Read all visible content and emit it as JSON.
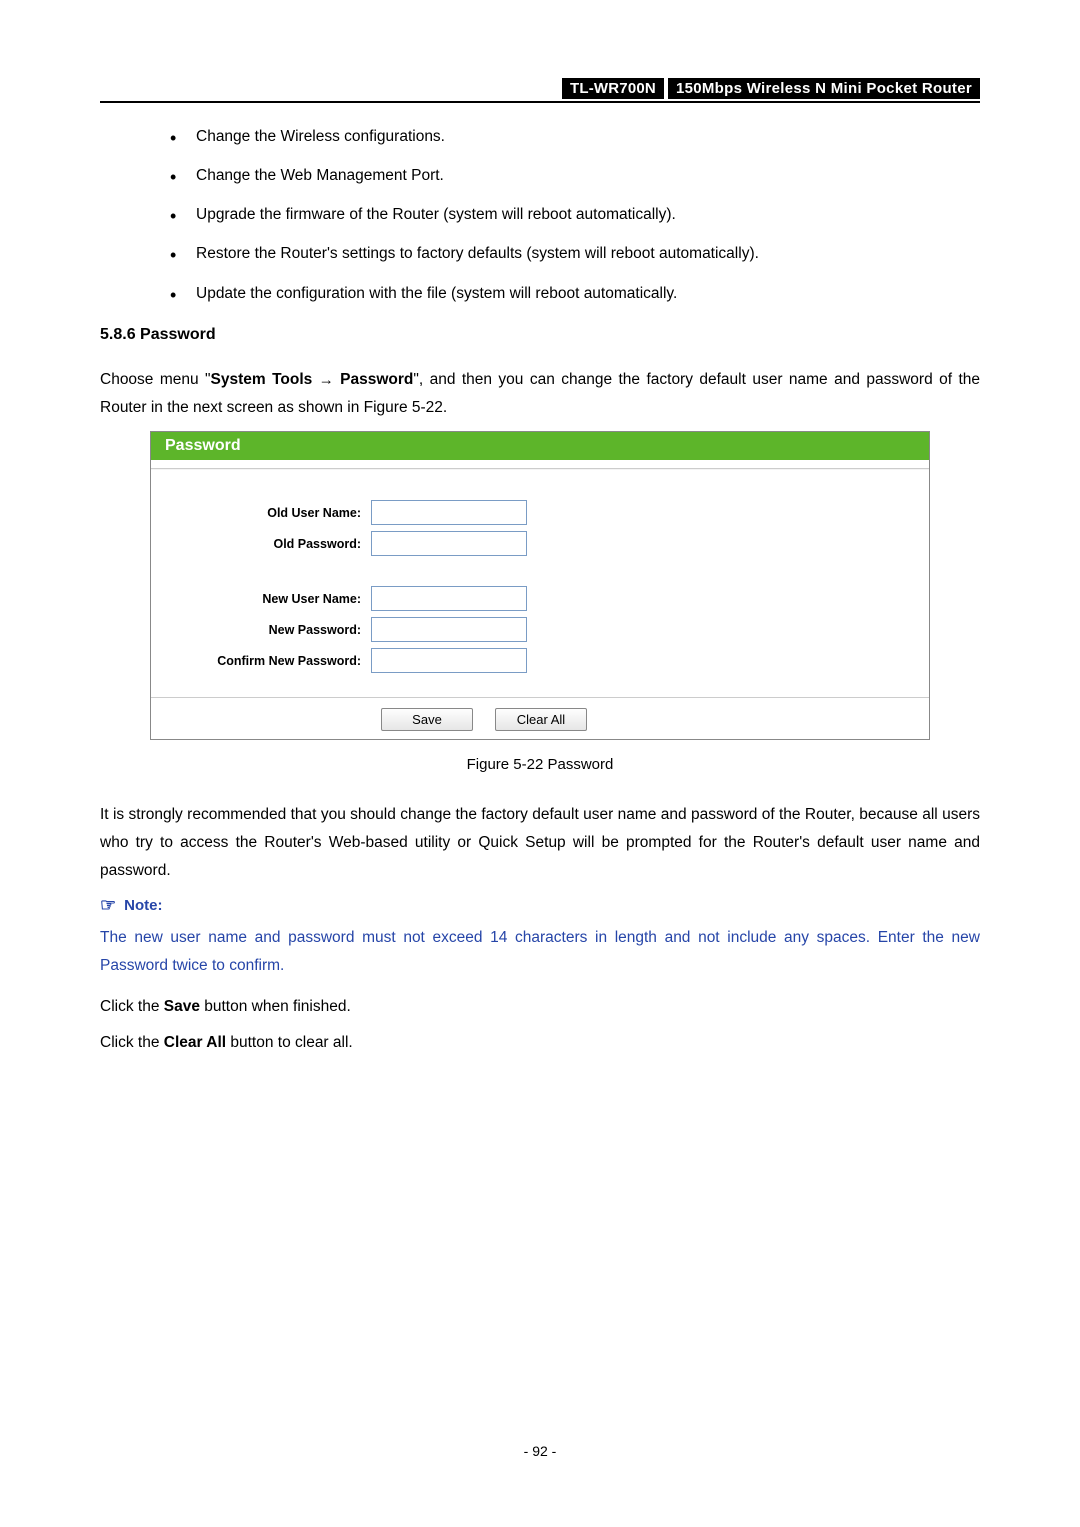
{
  "header": {
    "model": "TL-WR700N",
    "desc": "150Mbps Wireless N Mini Pocket Router"
  },
  "list": {
    "items": [
      "Change the Wireless configurations.",
      "Change the Web Management Port.",
      "Upgrade the firmware of the Router (system will reboot automatically).",
      "Restore the Router's settings to factory defaults (system will reboot automatically).",
      "Update the configuration with the file (system will reboot automatically."
    ]
  },
  "section": {
    "heading": "5.8.6  Password"
  },
  "intro": {
    "pre": "Choose menu \"",
    "menu1": "System Tools",
    "arrow": "→",
    "menu2": "Password",
    "post": "\", and then you can change the factory default user name and password of the Router in the next screen as shown in Figure 5-22."
  },
  "figure": {
    "title": "Password",
    "labels": {
      "old_user": "Old User Name:",
      "old_pass": "Old Password:",
      "new_user": "New User Name:",
      "new_pass": "New Password:",
      "confirm": "Confirm New Password:"
    },
    "buttons": {
      "save": "Save",
      "clear": "Clear All"
    },
    "caption": "Figure 5-22    Password"
  },
  "recommend": "It is strongly recommended that you should change the factory default user name and password of the Router, because all users who try to access the Router's Web-based utility or Quick Setup will be prompted for the Router's default user name and password.",
  "note": {
    "label": "Note:",
    "text": "The new user name and password must not exceed 14 characters in length and not include any spaces. Enter the new Password twice to confirm."
  },
  "instr1": {
    "pre": "Click the ",
    "bold": "Save",
    "post": " button when finished."
  },
  "instr2": {
    "pre": "Click the ",
    "bold": "Clear All",
    "post": " button to clear all."
  },
  "page_num": "- 92 -"
}
